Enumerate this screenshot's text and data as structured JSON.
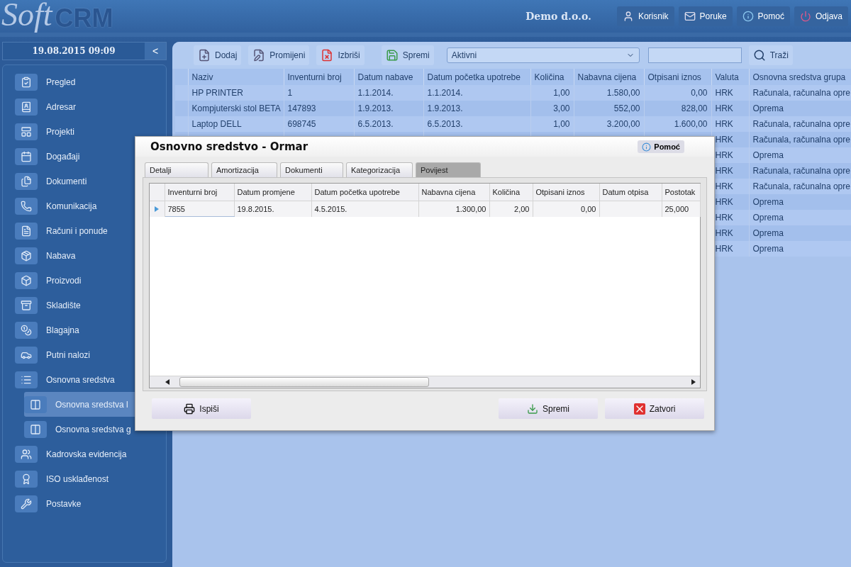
{
  "header": {
    "logo_script": "Soft",
    "logo_bold": "CRM",
    "company": "Demo d.o.o.",
    "buttons": [
      "Korisnik",
      "Poruke",
      "Pomoć",
      "Odjava"
    ]
  },
  "sidebar": {
    "datetime": "19.08.2015 09:09",
    "collapse": "<",
    "items": [
      {
        "label": "Pregled",
        "selected": false
      },
      {
        "label": "Adresar",
        "selected": false
      },
      {
        "label": "Projekti",
        "selected": false
      },
      {
        "label": "Događaji",
        "selected": false
      },
      {
        "label": "Dokumenti",
        "selected": false
      },
      {
        "label": "Komunikacija",
        "selected": false
      },
      {
        "label": "Računi i ponude",
        "selected": false
      },
      {
        "label": "Nabava",
        "selected": false
      },
      {
        "label": "Proizvodi",
        "selected": false
      },
      {
        "label": "Skladište",
        "selected": false
      },
      {
        "label": "Blagajna",
        "selected": false
      },
      {
        "label": "Putni nalozi",
        "selected": false
      },
      {
        "label": "Osnovna sredstva",
        "selected": false,
        "children": [
          {
            "label": "Osnovna sredstva l",
            "selected": true
          },
          {
            "label": "Osnovna sredstva g",
            "selected": false
          }
        ]
      },
      {
        "label": "Kadrovska evidencija",
        "selected": false
      },
      {
        "label": "ISO usklađenost",
        "selected": false
      },
      {
        "label": "Postavke",
        "selected": false
      }
    ]
  },
  "toolbar": {
    "buttons": [
      "Dodaj",
      "Promijeni",
      "Izbriši",
      "Spremi"
    ],
    "filter": "Aktivni",
    "search_button": "Traži"
  },
  "table": {
    "columns": [
      "Naziv",
      "Inventurni broj",
      "Datum nabave",
      "Datum početka upotrebe",
      "Količina",
      "Nabavna cijena",
      "Otpisani iznos",
      "Valuta",
      "Osnovna sredstva grupa"
    ],
    "rows": [
      {
        "cells": [
          "HP PRINTER",
          "1",
          "1.1.2014.",
          "1.1.2014.",
          "1,00",
          "1.580,00",
          "0,00",
          "HRK",
          "Računala, računalna opre"
        ]
      },
      {
        "cells": [
          "Kompjuterski stol BETA",
          "147893",
          "1.9.2013.",
          "1.9.2013.",
          "3,00",
          "552,00",
          "828,00",
          "HRK",
          "Oprema"
        ]
      },
      {
        "cells": [
          "Laptop DELL",
          "698745",
          "6.5.2013.",
          "6.5.2013.",
          "1,00",
          "3.200,00",
          "1.600,00",
          "HRK",
          "Računala, računalna opre"
        ]
      },
      {
        "cells": [
          null,
          null,
          null,
          null,
          null,
          null,
          null,
          "HRK",
          "Računala, računalna opre"
        ]
      },
      {
        "cells": [
          null,
          null,
          null,
          null,
          null,
          null,
          null,
          "HRK",
          "Oprema"
        ]
      },
      {
        "cells": [
          null,
          null,
          null,
          null,
          null,
          null,
          null,
          "HRK",
          "Računala, računalna opre"
        ]
      },
      {
        "cells": [
          null,
          null,
          null,
          null,
          null,
          null,
          null,
          "HRK",
          "Računala, računalna opre"
        ]
      },
      {
        "cells": [
          null,
          null,
          null,
          null,
          null,
          null,
          null,
          "HRK",
          "Oprema"
        ]
      },
      {
        "cells": [
          null,
          null,
          null,
          null,
          null,
          null,
          null,
          "HRK",
          "Oprema"
        ]
      },
      {
        "cells": [
          null,
          null,
          null,
          null,
          null,
          null,
          null,
          "HRK",
          "Oprema"
        ]
      },
      {
        "cells": [
          null,
          null,
          null,
          null,
          null,
          null,
          null,
          "HRK",
          "Oprema"
        ]
      }
    ]
  },
  "dialog": {
    "title": "Osnovno sredstvo - Ormar",
    "help": "Pomoć",
    "tabs": [
      {
        "label": "Detalji",
        "selected": false
      },
      {
        "label": "Amortizacija",
        "selected": false
      },
      {
        "label": "Dokumenti",
        "selected": false
      },
      {
        "label": "Kategorizacija",
        "selected": false
      },
      {
        "label": "Povijest",
        "selected": true
      }
    ],
    "grid": {
      "columns": [
        "Inventurni broj",
        "Datum promjene",
        "Datum početka upotrebe",
        "Nabavna cijena",
        "Količina",
        "Otpisani iznos",
        "Datum otpisa",
        "Postotak"
      ],
      "rows": [
        {
          "selected": true,
          "cells": [
            "7855",
            "19.8.2015.",
            "4.5.2015.",
            "1.300,00",
            "2,00",
            "0,00",
            null,
            "25,000"
          ]
        }
      ]
    },
    "print_button": "Ispiši",
    "save_button": "Spremi",
    "close_button": "Zatvori"
  }
}
